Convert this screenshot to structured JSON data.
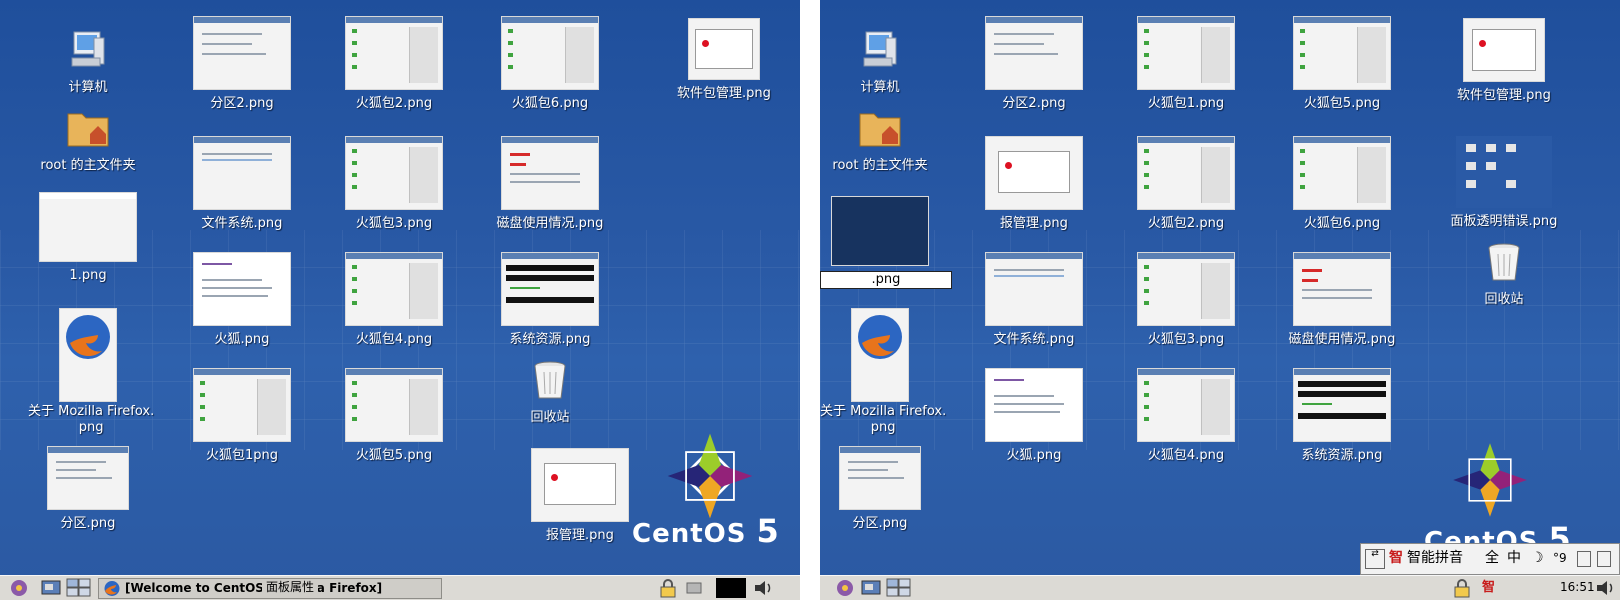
{
  "left_screen": {
    "icons": {
      "computer": "计算机",
      "home": "root 的主文件夹",
      "img1": "1.png",
      "about_firefox": "关于 Mozilla Firefox.\npng",
      "fenqu": "分区.png",
      "fenqu2": "分区2.png",
      "wenjian": "文件系统.png",
      "huohu": "火狐.png",
      "huohubao1": "火狐包1png",
      "huohubao2": "火狐包2.png",
      "huohubao3": "火狐包3.png",
      "huohubao4": "火狐包4.png",
      "huohubao5": "火狐包5.png",
      "huohubao6": "火狐包6.png",
      "cipan": "磁盘使用情况.png",
      "xitong": "系统资源.png",
      "recycle": "回收站",
      "baoguanli": "报管理.png",
      "ruanjianbao": "软件包管理.png"
    },
    "taskbar": {
      "task_label": "[Welcome to CentOS - Mozilla Firefox]",
      "overlay_label": "面板属性"
    }
  },
  "right_screen": {
    "icons": {
      "computer": "计算机",
      "home": "root 的主文件夹",
      "renaming": ".png",
      "about_firefox": "关于 Mozilla Firefox.\npng",
      "fenqu": "分区.png",
      "fenqu2": "分区2.png",
      "baoguanli": "报管理.png",
      "wenjian": "文件系统.png",
      "huohu": "火狐.png",
      "huohubao1": "火狐包1.png",
      "huohubao2": "火狐包2.png",
      "huohubao3": "火狐包3.png",
      "huohubao4": "火狐包4.png",
      "huohubao5": "火狐包5.png",
      "huohubao6": "火狐包6.png",
      "cipan": "磁盘使用情况.png",
      "xitong": "系统资源.png",
      "ruanjianbao": "软件包管理.png",
      "mianban": "面板透明错误.png",
      "recycle": "回收站"
    },
    "ime": {
      "name": "智能拼音",
      "full": "全",
      "zh": "中",
      "moon": "☽",
      "quote": "°9"
    },
    "clock": "16:51"
  },
  "logo": {
    "text": "CentOS",
    "version": "5"
  },
  "colors": {
    "desktop_blue": "#2a5aa6",
    "panel_gray": "#dcdad5"
  }
}
